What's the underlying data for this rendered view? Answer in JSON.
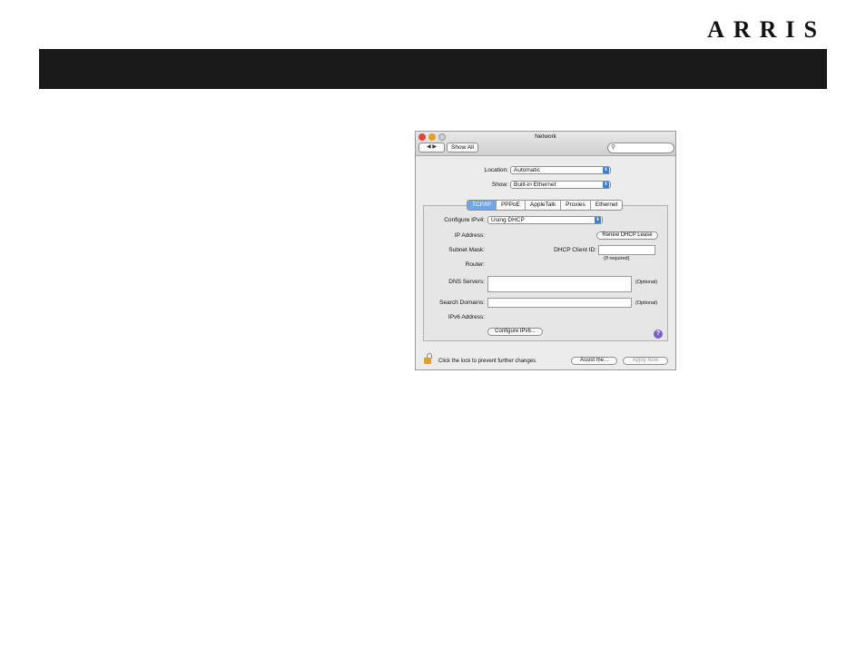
{
  "brand": "ARRIS",
  "window": {
    "title": "Network",
    "nav_glyph": "◀ ▶",
    "show_all": "Show All",
    "search_icon": "⚲"
  },
  "location": {
    "label": "Location:",
    "value": "Automatic"
  },
  "show": {
    "label": "Show:",
    "value": "Built-in Ethernet"
  },
  "tabs": [
    "TCP/IP",
    "PPPoE",
    "AppleTalk",
    "Proxies",
    "Ethernet"
  ],
  "active_tab": "TCP/IP",
  "form": {
    "configure_ipv4_label": "Configure IPv4:",
    "configure_ipv4_value": "Using DHCP",
    "ip_address_label": "IP Address:",
    "renew_button": "Renew DHCP Lease",
    "subnet_mask_label": "Subnet Mask:",
    "dhcp_client_id_label": "DHCP Client ID:",
    "if_required": "(If required)",
    "router_label": "Router:",
    "dns_servers_label": "DNS Servers:",
    "dns_optional": "(Optional)",
    "search_domains_label": "Search Domains:",
    "search_optional": "(Optional)",
    "ipv6_address_label": "IPv6 Address:",
    "configure_ipv6_button": "Configure IPv6...",
    "help_glyph": "?"
  },
  "footer": {
    "lock_text": "Click the lock to prevent further changes.",
    "assist_button": "Assist me...",
    "apply_button": "Apply Now"
  }
}
